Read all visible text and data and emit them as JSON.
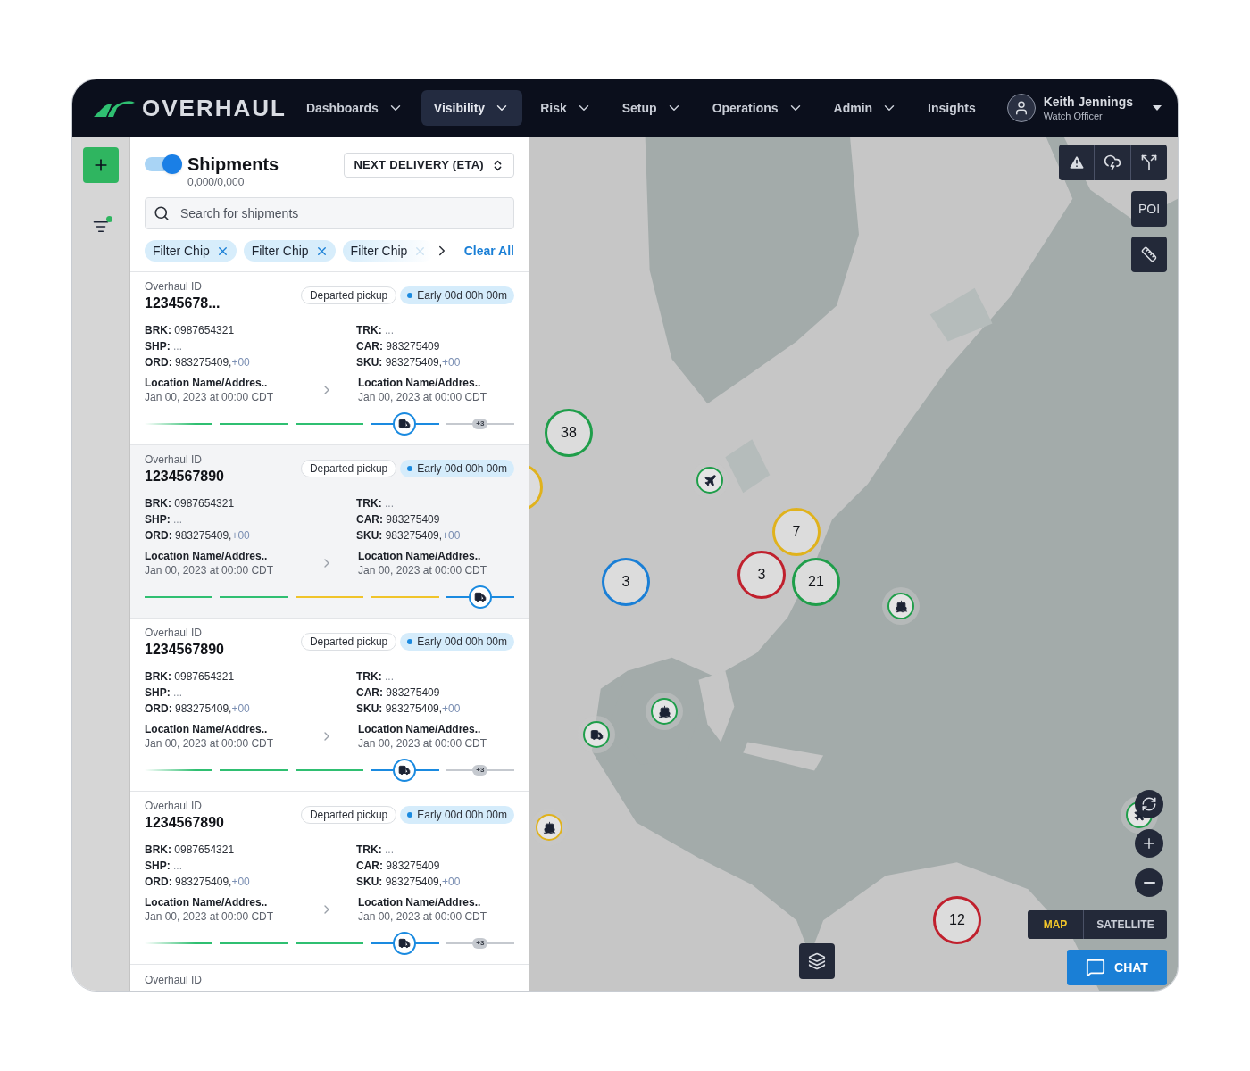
{
  "nav": {
    "logo": "OVERHAUL",
    "items": [
      {
        "label": "Dashboards",
        "dropdown": true,
        "selected": false
      },
      {
        "label": "Visibility",
        "dropdown": true,
        "selected": true
      },
      {
        "label": "Risk",
        "dropdown": true,
        "selected": false
      },
      {
        "label": "Setup",
        "dropdown": true,
        "selected": false
      },
      {
        "label": "Operations",
        "dropdown": true,
        "selected": false
      },
      {
        "label": "Admin",
        "dropdown": true,
        "selected": false
      },
      {
        "label": "Insights",
        "dropdown": false,
        "selected": false
      }
    ],
    "user": {
      "name": "Keith Jennings",
      "role": "Watch Officer"
    }
  },
  "rail": {
    "filters_active": true
  },
  "panel": {
    "toggle_on": true,
    "title": "Shipments",
    "count": "0,000/0,000",
    "sort": "NEXT DELIVERY (ETA)",
    "search": {
      "placeholder": "Search for shipments"
    },
    "chips": [
      {
        "label": "Filter Chip",
        "faded": false
      },
      {
        "label": "Filter Chip",
        "faded": false
      },
      {
        "label": "Filter Chip",
        "faded": true
      }
    ],
    "clear": "Clear All",
    "next_card_label": "Overhaul ID"
  },
  "shipments": [
    {
      "id_label": "Overhaul ID",
      "id": "12345678...",
      "selected": false,
      "status": "Departed pickup",
      "eta": "Early 00d 00h 00m",
      "left": [
        {
          "label": "BRK:",
          "value": "0987654321",
          "muted": false
        },
        {
          "label": "SHP:",
          "value": "...",
          "muted": true
        },
        {
          "label": "ORD:",
          "value": "983275409,",
          "extra": "+00",
          "muted": false
        }
      ],
      "right": [
        {
          "label": "TRK:",
          "value": "...",
          "muted": true
        },
        {
          "label": "CAR:",
          "value": "983275409",
          "muted": false
        },
        {
          "label": "SKU:",
          "value": "983275409,",
          "extra": "+00",
          "muted": false
        }
      ],
      "origin": {
        "name": "Location Name/Addres..",
        "date": "Jan 00, 2023 at 00:00 CDT"
      },
      "destination": {
        "name": "Location Name/Addres..",
        "date": "Jan 00, 2023 at 00:00 CDT"
      },
      "segments": [
        {
          "kind": "plain",
          "color": "#2fbf71",
          "faded": true
        },
        {
          "kind": "plain",
          "color": "#2fbf71",
          "faded": false
        },
        {
          "kind": "plain",
          "color": "#2fbf71",
          "faded": false
        },
        {
          "kind": "truck",
          "color": "#1a8ae0",
          "faded": false
        },
        {
          "kind": "badge",
          "color": "#c5c9cf",
          "faded": false,
          "badge": "+3"
        }
      ]
    },
    {
      "id_label": "Overhaul ID",
      "id": "1234567890",
      "selected": true,
      "status": "Departed pickup",
      "eta": "Early 00d 00h 00m",
      "left": [
        {
          "label": "BRK:",
          "value": "0987654321",
          "muted": false
        },
        {
          "label": "SHP:",
          "value": "...",
          "muted": true
        },
        {
          "label": "ORD:",
          "value": "983275409,",
          "extra": "+00",
          "muted": false
        }
      ],
      "right": [
        {
          "label": "TRK:",
          "value": "...",
          "muted": true
        },
        {
          "label": "CAR:",
          "value": "983275409",
          "muted": false
        },
        {
          "label": "SKU:",
          "value": "983275409,",
          "extra": "+00",
          "muted": false
        }
      ],
      "origin": {
        "name": "Location Name/Addres..",
        "date": "Jan 00, 2023 at 00:00 CDT"
      },
      "destination": {
        "name": "Location Name/Addres..",
        "date": "Jan 00, 2023 at 00:00 CDT"
      },
      "segments": [
        {
          "kind": "plain",
          "color": "#2fbf71",
          "faded": false
        },
        {
          "kind": "plain",
          "color": "#2fbf71",
          "faded": false
        },
        {
          "kind": "plain",
          "color": "#f0c42a",
          "faded": false
        },
        {
          "kind": "plain",
          "color": "#f0c42a",
          "faded": false
        },
        {
          "kind": "truck",
          "color": "#1a8ae0",
          "faded": false
        }
      ]
    },
    {
      "id_label": "Overhaul ID",
      "id": "1234567890",
      "selected": false,
      "status": "Departed pickup",
      "eta": "Early 00d 00h 00m",
      "left": [
        {
          "label": "BRK:",
          "value": "0987654321",
          "muted": false
        },
        {
          "label": "SHP:",
          "value": "...",
          "muted": true
        },
        {
          "label": "ORD:",
          "value": "983275409,",
          "extra": "+00",
          "muted": false
        }
      ],
      "right": [
        {
          "label": "TRK:",
          "value": "...",
          "muted": true
        },
        {
          "label": "CAR:",
          "value": "983275409",
          "muted": false
        },
        {
          "label": "SKU:",
          "value": "983275409,",
          "extra": "+00",
          "muted": false
        }
      ],
      "origin": {
        "name": "Location Name/Addres..",
        "date": "Jan 00, 2023 at 00:00 CDT"
      },
      "destination": {
        "name": "Location Name/Addres..",
        "date": "Jan 00, 2023 at 00:00 CDT"
      },
      "segments": [
        {
          "kind": "plain",
          "color": "#2fbf71",
          "faded": true
        },
        {
          "kind": "plain",
          "color": "#2fbf71",
          "faded": false
        },
        {
          "kind": "plain",
          "color": "#2fbf71",
          "faded": false
        },
        {
          "kind": "truck",
          "color": "#1a8ae0",
          "faded": false
        },
        {
          "kind": "badge",
          "color": "#c5c9cf",
          "faded": false,
          "badge": "+3"
        }
      ]
    },
    {
      "id_label": "Overhaul ID",
      "id": "1234567890",
      "selected": false,
      "status": "Departed pickup",
      "eta": "Early 00d 00h 00m",
      "left": [
        {
          "label": "BRK:",
          "value": "0987654321",
          "muted": false
        },
        {
          "label": "SHP:",
          "value": "...",
          "muted": true
        },
        {
          "label": "ORD:",
          "value": "983275409,",
          "extra": "+00",
          "muted": false
        }
      ],
      "right": [
        {
          "label": "TRK:",
          "value": "...",
          "muted": true
        },
        {
          "label": "CAR:",
          "value": "983275409",
          "muted": false
        },
        {
          "label": "SKU:",
          "value": "983275409,",
          "extra": "+00",
          "muted": false
        }
      ],
      "origin": {
        "name": "Location Name/Addres..",
        "date": "Jan 00, 2023 at 00:00 CDT"
      },
      "destination": {
        "name": "Location Name/Addres..",
        "date": "Jan 00, 2023 at 00:00 CDT"
      },
      "segments": [
        {
          "kind": "plain",
          "color": "#2fbf71",
          "faded": true
        },
        {
          "kind": "plain",
          "color": "#2fbf71",
          "faded": false
        },
        {
          "kind": "plain",
          "color": "#2fbf71",
          "faded": false
        },
        {
          "kind": "truck",
          "color": "#1a8ae0",
          "faded": false
        },
        {
          "kind": "badge",
          "color": "#c5c9cf",
          "faded": false,
          "badge": "+3"
        }
      ]
    }
  ],
  "map": {
    "markers": [
      {
        "kind": "cluster",
        "count": "38",
        "color": "#1f9e4a"
      },
      {
        "kind": "cluster",
        "color": "#e0b21c"
      },
      {
        "kind": "plane",
        "color": "#1f9e4a"
      },
      {
        "kind": "cluster",
        "count": "7",
        "color": "#e0b21c"
      },
      {
        "kind": "cluster",
        "count": "3",
        "color": "#c0202d"
      },
      {
        "kind": "cluster",
        "count": "21",
        "color": "#1f9e4a"
      },
      {
        "kind": "cluster",
        "count": "3",
        "color": "#1a7fd6"
      },
      {
        "kind": "ship",
        "color": "#1f9e4a"
      },
      {
        "kind": "ship",
        "color": "#1f9e4a"
      },
      {
        "kind": "truck",
        "color": "#1f9e4a"
      },
      {
        "kind": "ship",
        "color": "#e0b21c"
      },
      {
        "kind": "plane",
        "color": "#1f9e4a"
      },
      {
        "kind": "cluster",
        "count": "12",
        "color": "#c0202d"
      }
    ],
    "poi": "POI",
    "modes": [
      {
        "label": "MAP",
        "selected": true
      },
      {
        "label": "SATELLITE",
        "selected": false
      }
    ],
    "chat": "CHAT"
  }
}
